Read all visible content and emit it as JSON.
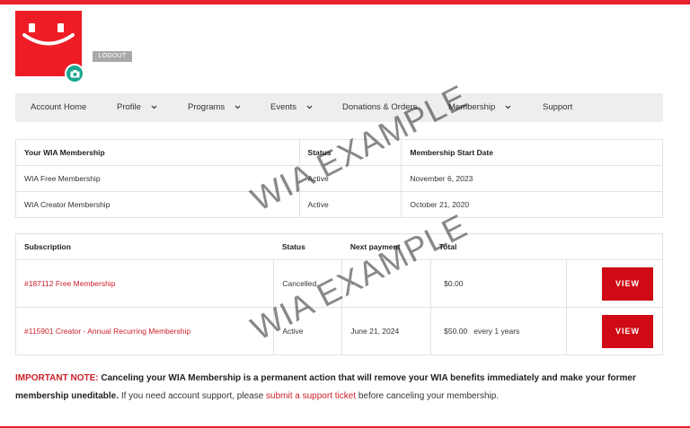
{
  "header": {
    "logout_label": "LOGOUT",
    "accent_color": "#ee1c25"
  },
  "nav": {
    "items": [
      {
        "label": "Account Home",
        "has_dropdown": false
      },
      {
        "label": "Profile",
        "has_dropdown": true
      },
      {
        "label": "Programs",
        "has_dropdown": true
      },
      {
        "label": "Events",
        "has_dropdown": true
      },
      {
        "label": "Donations & Orders",
        "has_dropdown": false
      },
      {
        "label": "Membership",
        "has_dropdown": true
      },
      {
        "label": "Support",
        "has_dropdown": false
      }
    ]
  },
  "memberships": {
    "columns": [
      "Your WIA Membership",
      "Status",
      "Membership Start Date"
    ],
    "rows": [
      {
        "name": "WIA Free Membership",
        "status": "Active",
        "start": "November 6, 2023"
      },
      {
        "name": "WIA Creator Membership",
        "status": "Active",
        "start": "October 21, 2020"
      }
    ]
  },
  "subscriptions": {
    "columns": [
      "Subscription",
      "Status",
      "Next payment",
      "Total"
    ],
    "rows": [
      {
        "name": "#187112 Free Membership",
        "status": "Cancelled",
        "next": "-",
        "total": "$0.00",
        "view_label": "VIEW"
      },
      {
        "name": "#115901 Creator - Annual Recurring Membership",
        "status": "Active",
        "next": "June 21, 2024",
        "total": "$50.00   every 1 years",
        "view_label": "VIEW"
      }
    ]
  },
  "watermark_text": "WIA EXAMPLE",
  "note": {
    "label": "IMPORTANT NOTE:",
    "bold_text": "Canceling your WIA Membership is a permanent action that will remove your WIA benefits immediately and make your former membership uneditable.",
    "text_before_link": "If you need account support, please",
    "link_text": "submit a support ticket",
    "text_after_link": "before canceling your membership."
  }
}
